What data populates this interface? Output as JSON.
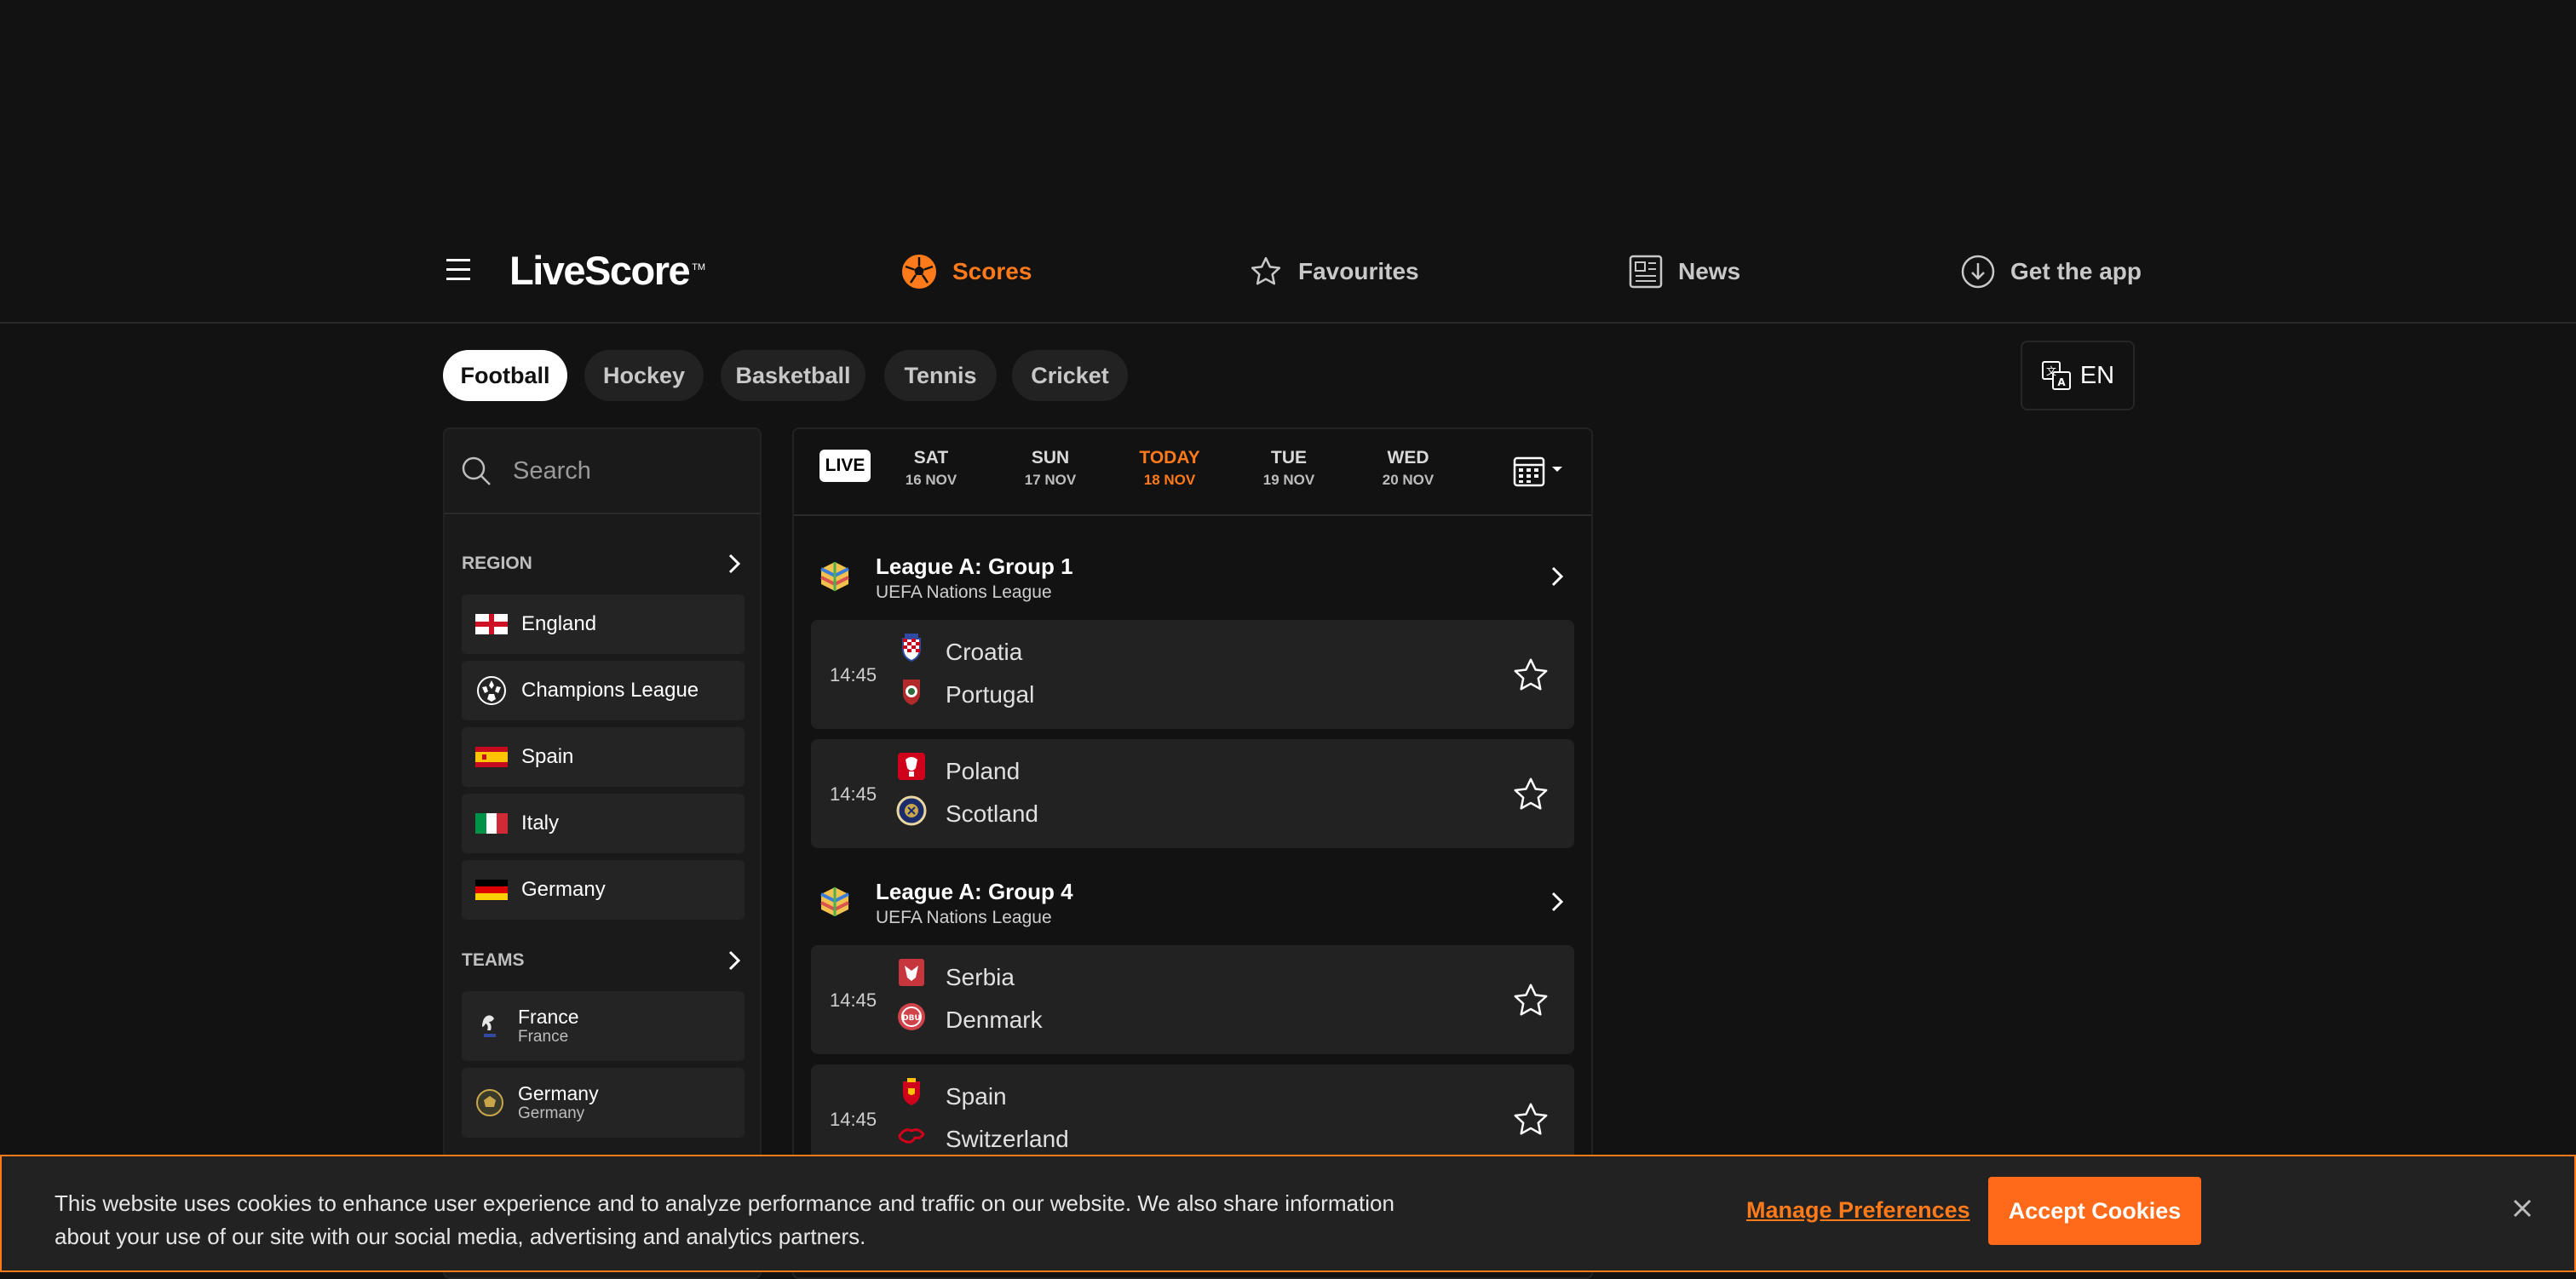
{
  "header": {
    "logo": "LiveScore",
    "logo_tm": "TM",
    "nav": {
      "scores": "Scores",
      "favourites": "Favourites",
      "news": "News",
      "get_app": "Get the app"
    }
  },
  "sports_tabs": [
    "Football",
    "Hockey",
    "Basketball",
    "Tennis",
    "Cricket"
  ],
  "language": "EN",
  "sidebar": {
    "search_placeholder": "Search",
    "region_title": "REGION",
    "regions": [
      "England",
      "Champions League",
      "Spain",
      "Italy",
      "Germany"
    ],
    "teams_title": "TEAMS",
    "teams": [
      {
        "name": "France",
        "country": "France"
      },
      {
        "name": "Germany",
        "country": "Germany"
      }
    ]
  },
  "datebar": {
    "live": "LIVE",
    "dates": [
      {
        "day": "SAT",
        "date": "16 NOV"
      },
      {
        "day": "SUN",
        "date": "17 NOV"
      },
      {
        "day": "TODAY",
        "date": "18 NOV"
      },
      {
        "day": "TUE",
        "date": "19 NOV"
      },
      {
        "day": "WED",
        "date": "20 NOV"
      }
    ]
  },
  "competitions": [
    {
      "name": "League A: Group 1",
      "sub": "UEFA Nations League",
      "matches": [
        {
          "time": "14:45",
          "home": "Croatia",
          "away": "Portugal"
        },
        {
          "time": "14:45",
          "home": "Poland",
          "away": "Scotland"
        }
      ]
    },
    {
      "name": "League A: Group 4",
      "sub": "UEFA Nations League",
      "matches": [
        {
          "time": "14:45",
          "home": "Serbia",
          "away": "Denmark"
        },
        {
          "time": "14:45",
          "home": "Spain",
          "away": "Switzerland"
        }
      ]
    }
  ],
  "cookie": {
    "text": "This website uses cookies to enhance user experience and to analyze performance and traffic on our website. We also share information about your use of our site with our social media, advertising and analytics partners.",
    "manage": "Manage Preferences",
    "accept": "Accept Cookies"
  },
  "colors": {
    "accent": "#ff7a1a",
    "background": "#121212",
    "card": "#222222"
  }
}
